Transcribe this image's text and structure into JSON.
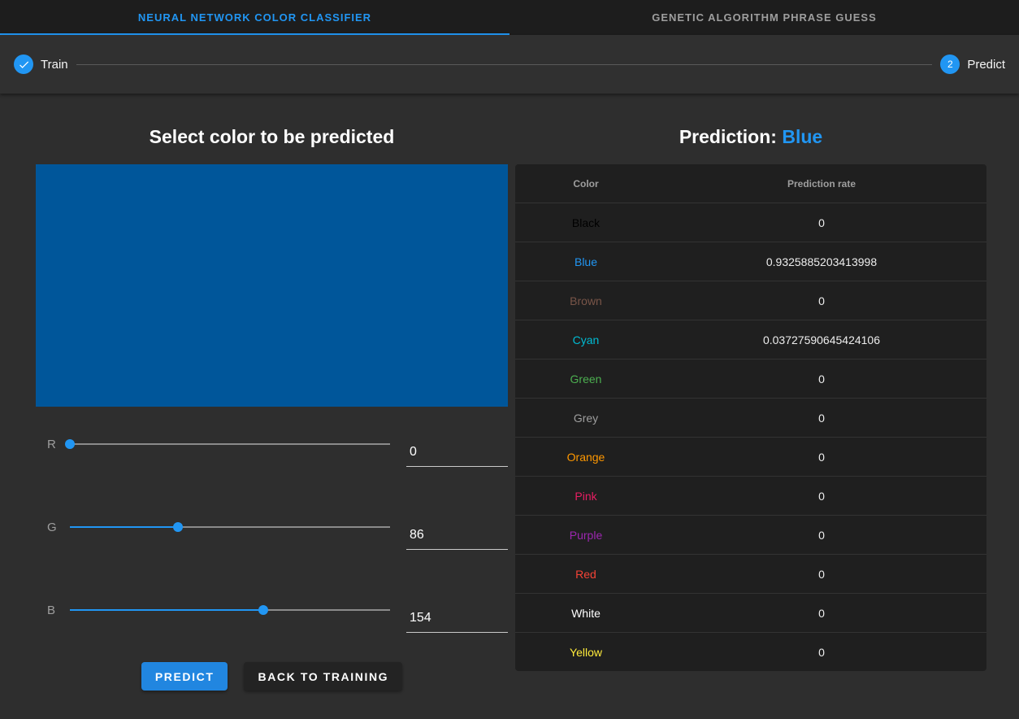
{
  "tabs": [
    {
      "label": "NEURAL NETWORK COLOR CLASSIFIER",
      "active": true
    },
    {
      "label": "GENETIC ALGORITHM PHRASE GUESS",
      "active": false
    }
  ],
  "stepper": {
    "steps": [
      {
        "label": "Train",
        "icon": "check-icon",
        "completed": true
      },
      {
        "label": "Predict",
        "number": "2",
        "active": true
      }
    ]
  },
  "left_panel": {
    "title": "Select color to be predicted",
    "swatch_color": "#00569a",
    "sliders": [
      {
        "label": "R",
        "value": "0",
        "max": 255
      },
      {
        "label": "G",
        "value": "86",
        "max": 255
      },
      {
        "label": "B",
        "value": "154",
        "max": 255
      }
    ],
    "buttons": {
      "predict": "PREDICT",
      "back": "BACK TO TRAINING"
    }
  },
  "right_panel": {
    "title_prefix": "Prediction: ",
    "predicted_color": "Blue",
    "table": {
      "headers": [
        "Color",
        "Prediction rate"
      ],
      "rows": [
        {
          "color": "Black",
          "hex": "#000000",
          "rate": "0"
        },
        {
          "color": "Blue",
          "hex": "#2196f3",
          "rate": "0.9325885203413998"
        },
        {
          "color": "Brown",
          "hex": "#795548",
          "rate": "0"
        },
        {
          "color": "Cyan",
          "hex": "#00bcd4",
          "rate": "0.03727590645424106"
        },
        {
          "color": "Green",
          "hex": "#4caf50",
          "rate": "0"
        },
        {
          "color": "Grey",
          "hex": "#9e9e9e",
          "rate": "0"
        },
        {
          "color": "Orange",
          "hex": "#ff9800",
          "rate": "0"
        },
        {
          "color": "Pink",
          "hex": "#e91e63",
          "rate": "0"
        },
        {
          "color": "Purple",
          "hex": "#9c27b0",
          "rate": "0"
        },
        {
          "color": "Red",
          "hex": "#f44336",
          "rate": "0"
        },
        {
          "color": "White",
          "hex": "#ffffff",
          "rate": "0"
        },
        {
          "color": "Yellow",
          "hex": "#ffeb3b",
          "rate": "0"
        }
      ]
    }
  },
  "colors": {
    "accent": "#2196f3",
    "topbar_bg": "#1d1d1d",
    "page_bg": "#2e2e2e",
    "card_bg": "#1f1f1f"
  }
}
